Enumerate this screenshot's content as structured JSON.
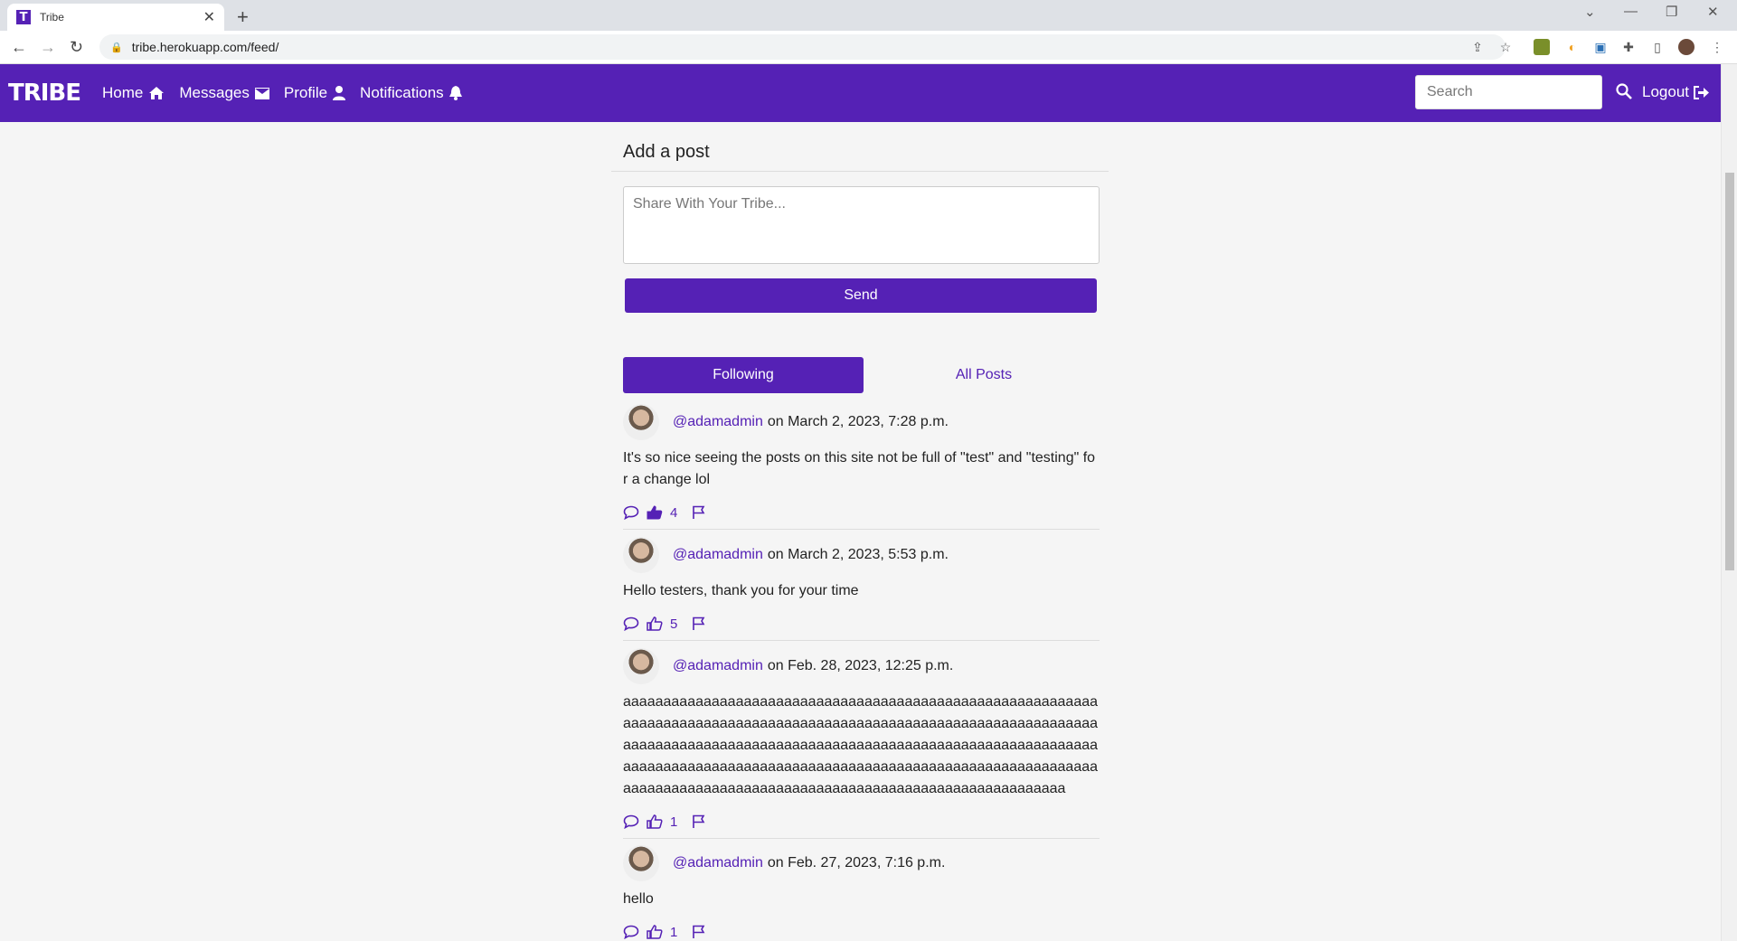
{
  "browser": {
    "tab_title": "Tribe",
    "url": "tribe.herokuapp.com/feed/"
  },
  "nav": {
    "brand": "TRIBE",
    "home": "Home",
    "messages": "Messages",
    "profile": "Profile",
    "notifications": "Notifications",
    "search_placeholder": "Search",
    "logout": "Logout"
  },
  "add_post": {
    "title": "Add a post",
    "placeholder": "Share With Your Tribe...",
    "send": "Send"
  },
  "tabs": {
    "following": "Following",
    "all_posts": "All Posts"
  },
  "posts": [
    {
      "user": "@adamadmin",
      "date": "on March 2, 2023, 7:28 p.m.",
      "body": "It's so nice seeing the posts on this site not be full of \"test\" and \"testing\" for a change lol",
      "likes": "4",
      "liked": true
    },
    {
      "user": "@adamadmin",
      "date": "on March 2, 2023, 5:53 p.m.",
      "body": "Hello testers, thank you for your time",
      "likes": "5",
      "liked": false
    },
    {
      "user": "@adamadmin",
      "date": "on Feb. 28, 2023, 12:25 p.m.",
      "body": "aaaaaaaaaaaaaaaaaaaaaaaaaaaaaaaaaaaaaaaaaaaaaaaaaaaaaaaaaaaaaaaaaaaaaaaaaaaaaaaaaaaaaaaaaaaaaaaaaaaaaaaaaaaaaaaaaaaaaaaaaaaaaaaaaaaaaaaaaaaaaaaaaaaaaaaaaaaaaaaaaaaaaaaaaaaaaaaaaaaaaaaaaaaaaaaaaaaaaaaaaaaaaaaaaaaaaaaaaaaaaaaaaaaaaaaaaaaaaaaaaaaaaaaaaaaaaaaaaaaaaaaaaaaaaaaaaaaaaaaaaaaaaaaaaaa",
      "likes": "1",
      "liked": false
    },
    {
      "user": "@adamadmin",
      "date": "on Feb. 27, 2023, 7:16 p.m.",
      "body": "hello",
      "likes": "1",
      "liked": false
    }
  ],
  "colors": {
    "brand": "#5521b5"
  }
}
